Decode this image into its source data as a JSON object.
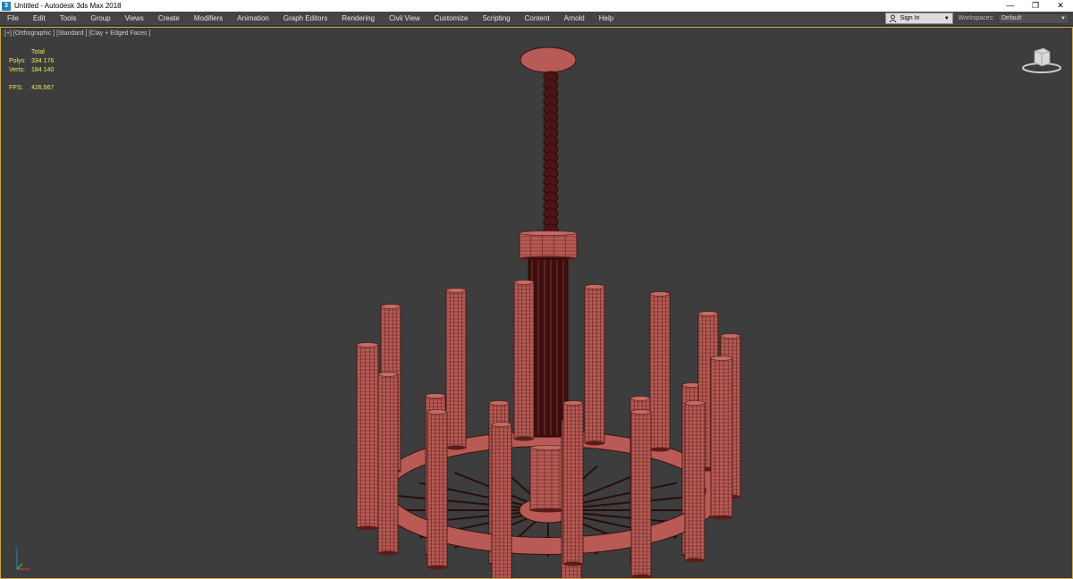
{
  "window": {
    "title": "Untitled - Autodesk 3ds Max 2018",
    "controls": [
      "—",
      "❐",
      "✕"
    ]
  },
  "menu": [
    "File",
    "Edit",
    "Tools",
    "Group",
    "Views",
    "Create",
    "Modifiers",
    "Animation",
    "Graph Editors",
    "Rendering",
    "Civil View",
    "Customize",
    "Scripting",
    "Content",
    "Arnold",
    "Help"
  ],
  "account": {
    "sign_in": "Sign In"
  },
  "workspace": {
    "label": "Workspaces:",
    "value": "Default"
  },
  "viewport": {
    "label": "[+] [Orthographic ] [Standard ] [Clay + Edged Faces ]",
    "stats": {
      "header": "Total",
      "polys_label": "Polys:",
      "polys_value": "334 176",
      "verts_label": "Verts:",
      "verts_value": "184 140",
      "fps_label": "FPS:",
      "fps_value": "426,567"
    }
  },
  "colors": {
    "mesh_fill": "#b85a55",
    "mesh_line": "#3a1210",
    "stats_text": "#e8e85a",
    "viewport_bg": "#3d3d3d"
  }
}
